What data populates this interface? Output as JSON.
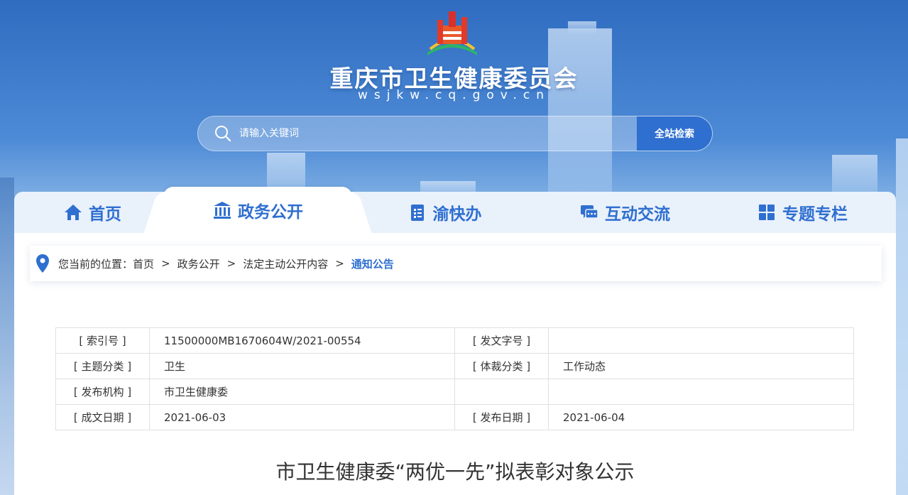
{
  "site": {
    "title": "重庆市卫生健康委员会",
    "domain": "wsjkw.cq.gov.cn"
  },
  "search": {
    "placeholder": "请输入关键词",
    "button_label": "全站检索"
  },
  "nav": {
    "items": [
      {
        "label": "首页",
        "icon": "home-icon"
      },
      {
        "label": "政务公开",
        "icon": "government-building-icon"
      },
      {
        "label": "渝快办",
        "icon": "clipboard-list-icon"
      },
      {
        "label": "互动交流",
        "icon": "chat-bubbles-icon"
      },
      {
        "label": "专题专栏",
        "icon": "grid-icon"
      }
    ],
    "active_index": 1
  },
  "breadcrumb": {
    "prefix": "您当前的位置：",
    "items": [
      "首页",
      "政务公开",
      "法定主动公开内容",
      "通知公告"
    ],
    "separator": ">"
  },
  "meta_table": {
    "rows": [
      {
        "label1": "[ 索引号 ]",
        "value1": "11500000MB1670604W/2021-00554",
        "label2": "[ 发文字号 ]",
        "value2": ""
      },
      {
        "label1": "[ 主题分类 ]",
        "value1": "卫生",
        "label2": "[ 体裁分类 ]",
        "value2": "工作动态"
      },
      {
        "label1": "[ 发布机构 ]",
        "value1": "市卫生健康委",
        "label2": "",
        "value2": ""
      },
      {
        "label1": "[ 成文日期 ]",
        "value1": "2021-06-03",
        "label2": "[ 发布日期 ]",
        "value2": "2021-06-04"
      }
    ]
  },
  "article": {
    "title": "市卫生健康委“两优一先”拟表彰对象公示"
  },
  "colors": {
    "accent": "#2f6fd0",
    "header_bg": "#2f6cc0",
    "text": "#333333"
  }
}
